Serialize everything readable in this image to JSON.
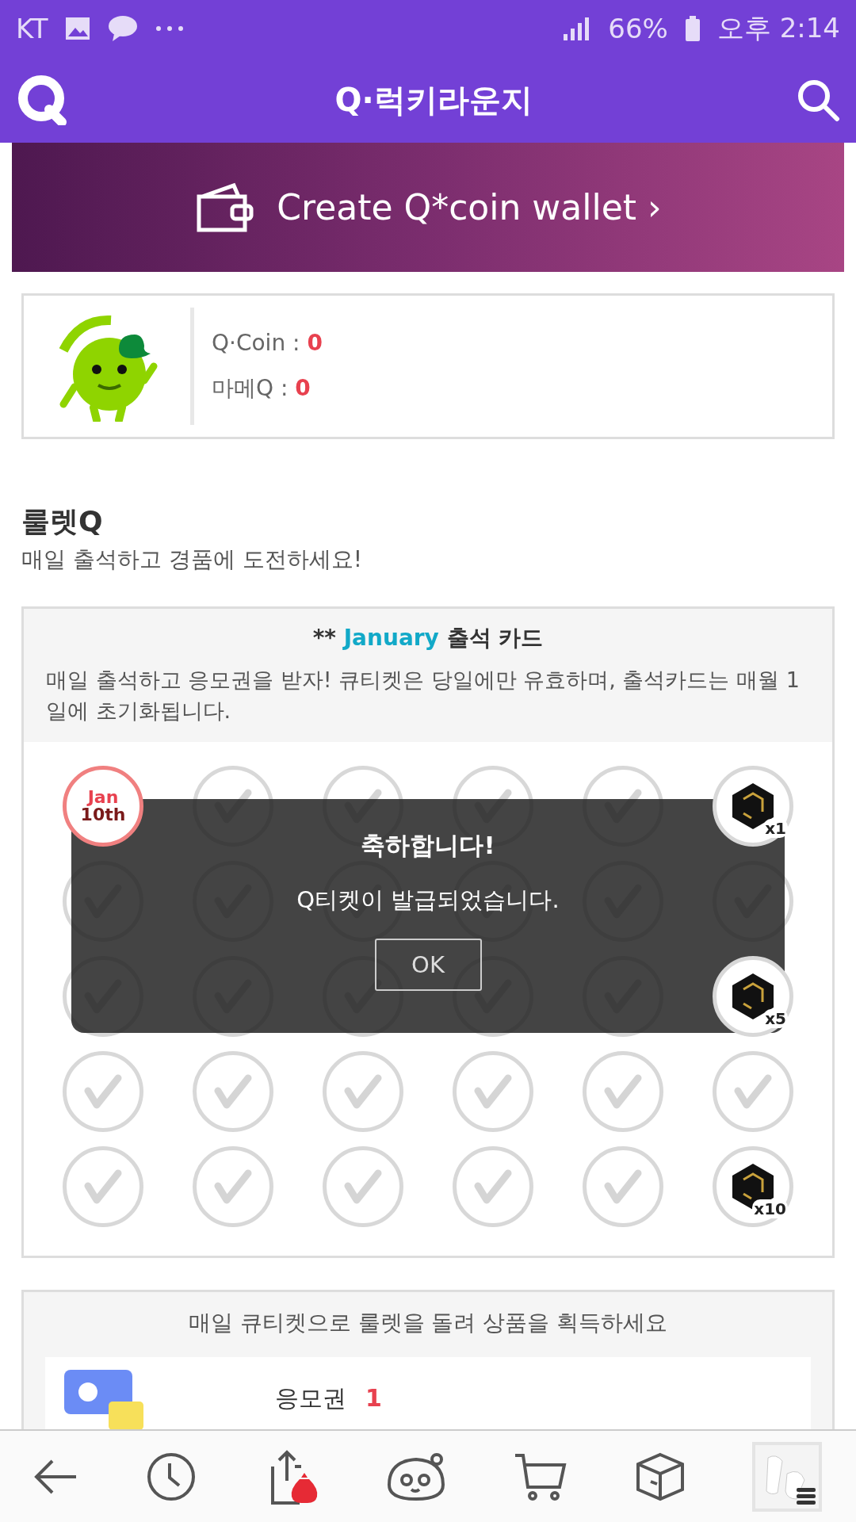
{
  "status_bar": {
    "carrier": "KT",
    "battery": "66%",
    "time": "오후 2:14"
  },
  "header": {
    "title": "Q·럭키라운지"
  },
  "banner": {
    "text": "Create Q*coin wallet ›"
  },
  "wallet": {
    "rows": [
      {
        "label": "Q·Coin : ",
        "value": "0"
      },
      {
        "label": "마메Q : ",
        "value": "0"
      }
    ]
  },
  "roulette": {
    "title": "룰렛Q",
    "subtitle": "매일 출석하고 경품에 도전하세요!"
  },
  "attendance": {
    "prefix": "** ",
    "month": "January",
    "suffix": " 출석 카드",
    "description": "매일 출석하고 응모권을 받자! 큐티켓은 당일에만 유효하며, 출석카드는 매월 1일에 초기화됩니다.",
    "rows": [
      [
        {
          "kind": "today",
          "month": "Jan",
          "day": "10th"
        },
        {
          "kind": "check"
        },
        {
          "kind": "check"
        },
        {
          "kind": "check"
        },
        {
          "kind": "check"
        },
        {
          "kind": "ticket",
          "count": "x1"
        }
      ],
      [
        {
          "kind": "check"
        },
        {
          "kind": "check"
        },
        {
          "kind": "check"
        },
        {
          "kind": "check"
        },
        {
          "kind": "check"
        },
        {
          "kind": "check"
        }
      ],
      [
        {
          "kind": "check"
        },
        {
          "kind": "check"
        },
        {
          "kind": "check"
        },
        {
          "kind": "check"
        },
        {
          "kind": "check"
        },
        {
          "kind": "ticket",
          "count": "x5"
        }
      ],
      [
        {
          "kind": "check"
        },
        {
          "kind": "check"
        },
        {
          "kind": "check"
        },
        {
          "kind": "check"
        },
        {
          "kind": "check"
        },
        {
          "kind": "check"
        }
      ],
      [
        {
          "kind": "check"
        },
        {
          "kind": "check"
        },
        {
          "kind": "check"
        },
        {
          "kind": "check"
        },
        {
          "kind": "check"
        },
        {
          "kind": "ticket",
          "count": "x10"
        }
      ]
    ]
  },
  "dialog": {
    "title": "축하합니다!",
    "message": "Q티켓이 발급되었습니다.",
    "button": "OK"
  },
  "prize": {
    "caption": "매일 큐티켓으로 룰렛을 돌려 상품을 획득하세요",
    "label": "응모권",
    "count": "1"
  },
  "bottom_nav": {
    "items": [
      {
        "kind": "back"
      },
      {
        "kind": "history"
      },
      {
        "kind": "share"
      },
      {
        "kind": "mascot"
      },
      {
        "kind": "cart"
      },
      {
        "kind": "box"
      },
      {
        "kind": "picture"
      }
    ]
  }
}
